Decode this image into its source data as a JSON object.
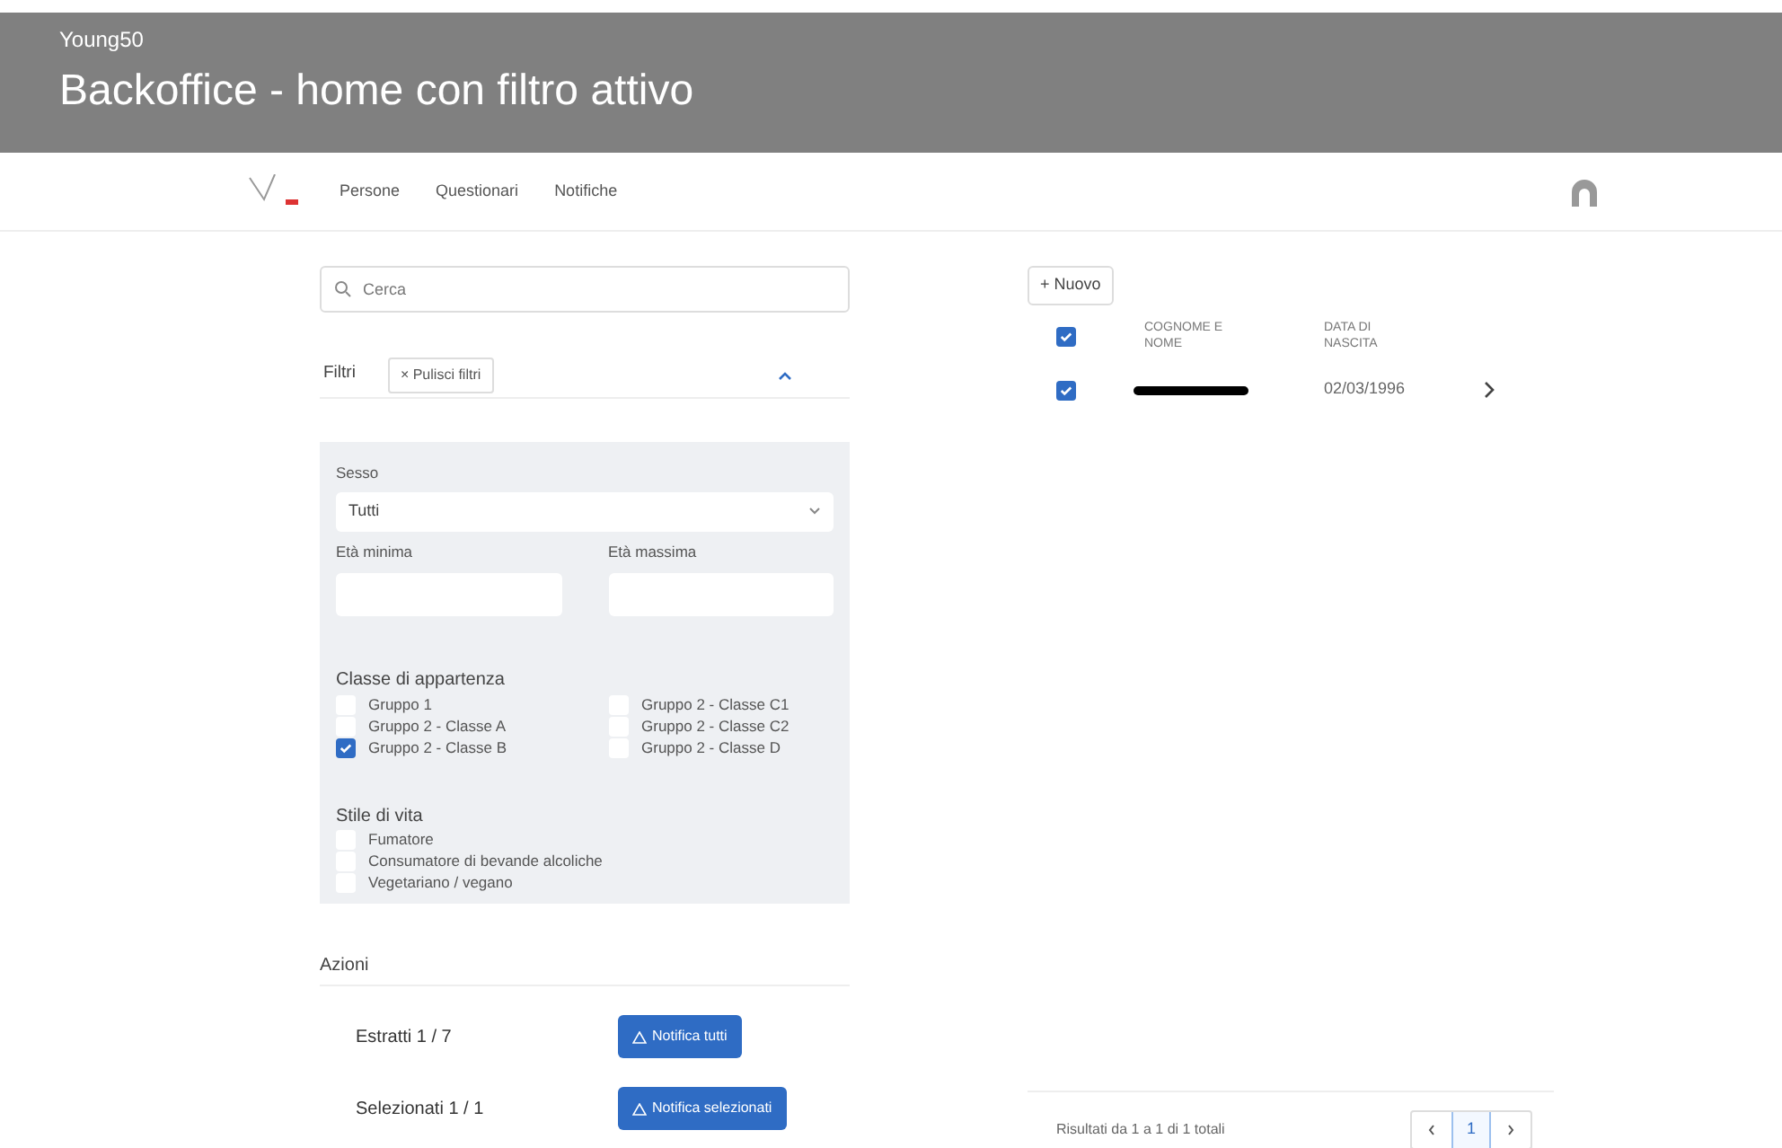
{
  "banner": {
    "app": "Young50",
    "title": "Backoffice - home con filtro attivo"
  },
  "nav": {
    "items": [
      {
        "label": "Persone"
      },
      {
        "label": "Questionari"
      },
      {
        "label": "Notifiche"
      }
    ]
  },
  "search": {
    "placeholder": "Cerca"
  },
  "filters": {
    "title": "Filtri",
    "clear": "× Pulisci filtri",
    "expanded": true,
    "sex": {
      "label": "Sesso",
      "value": "Tutti"
    },
    "age_min": {
      "label": "Età minima"
    },
    "age_max": {
      "label": "Età massima"
    },
    "classes": {
      "title": "Classe di appartenza",
      "options": [
        {
          "label": "Gruppo 1",
          "checked": false
        },
        {
          "label": "Gruppo 2 - Classe A",
          "checked": false
        },
        {
          "label": "Gruppo 2 - Classe B",
          "checked": true
        },
        {
          "label": "Gruppo 2 - Classe C1",
          "checked": false
        },
        {
          "label": "Gruppo 2 - Classe C2",
          "checked": false
        },
        {
          "label": "Gruppo 2 - Classe D",
          "checked": false
        }
      ]
    },
    "lifestyle": {
      "title": "Stile di vita",
      "options": [
        {
          "label": "Fumatore",
          "checked": false
        },
        {
          "label": "Consumatore di bevande alcoliche",
          "checked": false
        },
        {
          "label": "Vegetariano / vegano",
          "checked": false
        }
      ]
    }
  },
  "actions": {
    "title": "Azioni",
    "rows": [
      {
        "label": "Estratti 1 / 7",
        "button": "Notifica tutti"
      },
      {
        "label": "Selezionati 1 / 1",
        "button": "Notifica selezionati"
      }
    ]
  },
  "table": {
    "new_button": "+ Nuovo",
    "header_checked": true,
    "columns": [
      "COGNOME E NOME",
      "DATA DI NASCITA"
    ],
    "rows": [
      {
        "checked": true,
        "birth": "02/03/1996"
      }
    ]
  },
  "pagination": {
    "summary": "Risultati da 1 a 1 di 1 totali",
    "pages": [
      {
        "label": "1",
        "selected": true
      }
    ]
  }
}
